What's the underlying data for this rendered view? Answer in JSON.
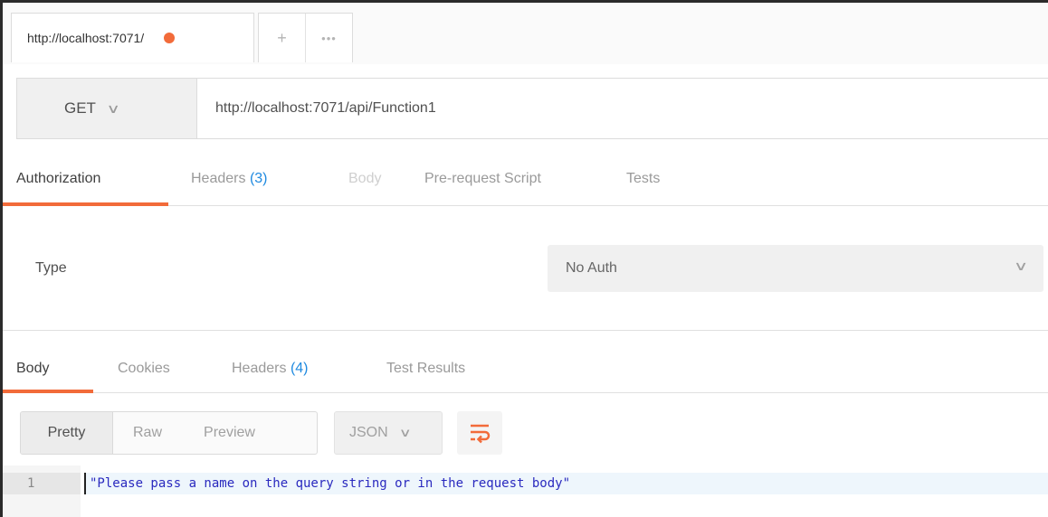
{
  "tab": {
    "label": "http://localhost:7071/",
    "dirty_indicator_color": "#f26b3a"
  },
  "tab_actions": {
    "add_label": "+",
    "more_label": "•••"
  },
  "request": {
    "method": "GET",
    "url": "http://localhost:7071/api/Function1"
  },
  "request_tabs": {
    "authorization": "Authorization",
    "headers": "Headers",
    "headers_count": "(3)",
    "body": "Body",
    "prerequest": "Pre-request Script",
    "tests": "Tests"
  },
  "auth": {
    "type_label": "Type",
    "selected": "No Auth"
  },
  "response_tabs": {
    "body": "Body",
    "cookies": "Cookies",
    "headers": "Headers",
    "headers_count": "(4)",
    "test_results": "Test Results"
  },
  "view_modes": {
    "pretty": "Pretty",
    "raw": "Raw",
    "preview": "Preview"
  },
  "format": "JSON",
  "editor": {
    "line_number": "1",
    "line_text": "\"Please pass a name on the query string or in the request body\""
  },
  "colors": {
    "accent": "#f26b3a",
    "count": "#1f8ae0",
    "code": "#2a2abf"
  }
}
